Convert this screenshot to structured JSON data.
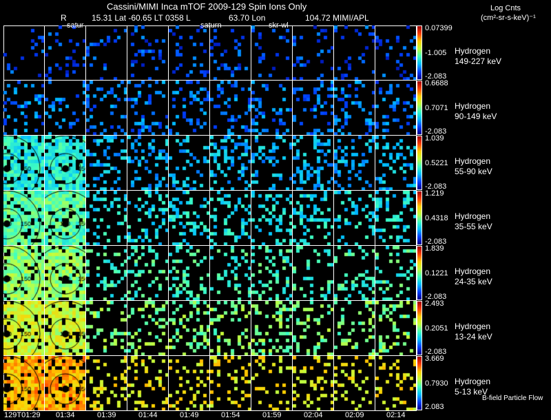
{
  "header": {
    "title": "Cassini/MIMI Inca mTOF  2009-129   Spin   Ions Only",
    "r_label": "R",
    "position_line": "15.31 Lat -60.65 LT 0358 L",
    "lon": "63.70 Lon",
    "lon_value": "104.72  MIMI/APL",
    "units_title": "Log Cnts",
    "units": "(cm²-sr-s-keV)⁻¹"
  },
  "overlay_labels": [
    "satur",
    "saturn",
    "skr-wl"
  ],
  "footer": {
    "legend": "B-field Particle Flow"
  },
  "chart_data": {
    "type": "heatmap",
    "title": "Cassini/MIMI Inca mTOF  2009-129   Spin   Ions Only",
    "times": [
      "129T01:29",
      "01:34",
      "01:39",
      "01:44",
      "01:49",
      "01:54",
      "01:59",
      "02:04",
      "02:09",
      "02:14"
    ],
    "rows": [
      {
        "species": "Hydrogen",
        "energy": "149-227 keV",
        "cbar_max": "0.07399",
        "cbar_mid": "-1.005",
        "cbar_min": "-2.083",
        "level": 0.15,
        "density": 0.12
      },
      {
        "species": "Hydrogen",
        "energy": "90-149 keV",
        "cbar_max": "0.6688",
        "cbar_mid": "0.7071",
        "cbar_min": "-2.083",
        "level": 0.2,
        "density": 0.2
      },
      {
        "species": "Hydrogen",
        "energy": "55-90 keV",
        "cbar_max": "1.039",
        "cbar_mid": "0.5221",
        "cbar_min": "-2.083",
        "level": 0.28,
        "density": 0.25
      },
      {
        "species": "Hydrogen",
        "energy": "35-55 keV",
        "cbar_max": "1.219",
        "cbar_mid": "0.4318",
        "cbar_min": "-2.083",
        "level": 0.35,
        "density": 0.25
      },
      {
        "species": "Hydrogen",
        "energy": "24-35 keV",
        "cbar_max": "1.839",
        "cbar_mid": "0.1221",
        "cbar_min": "-2.083",
        "level": 0.42,
        "density": 0.22
      },
      {
        "species": "Hydrogen",
        "energy": "13-24 keV",
        "cbar_max": "2.493",
        "cbar_mid": "0.2051",
        "cbar_min": "-2.083",
        "level": 0.5,
        "density": 0.25
      },
      {
        "species": "Hydrogen",
        "energy": "5-13 keV",
        "cbar_max": "3.669",
        "cbar_mid": "0.7930",
        "cbar_min": "2.083",
        "level": 0.65,
        "density": 0.18
      }
    ]
  }
}
